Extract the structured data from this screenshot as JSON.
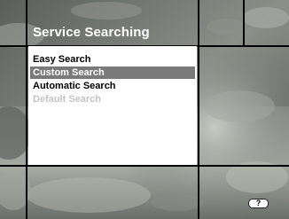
{
  "title": "Service Searching",
  "menu": {
    "items": [
      {
        "label": "Easy Search",
        "state": "normal"
      },
      {
        "label": "Custom Search",
        "state": "selected"
      },
      {
        "label": "Automatic Search",
        "state": "normal"
      },
      {
        "label": "Default Search",
        "state": "disabled"
      }
    ]
  },
  "help": {
    "label": "?"
  },
  "colors": {
    "selection": "#7a7a7a",
    "disabled_text": "#c4c4c4",
    "grid_lines": "#000000",
    "panel": "#ffffff"
  }
}
